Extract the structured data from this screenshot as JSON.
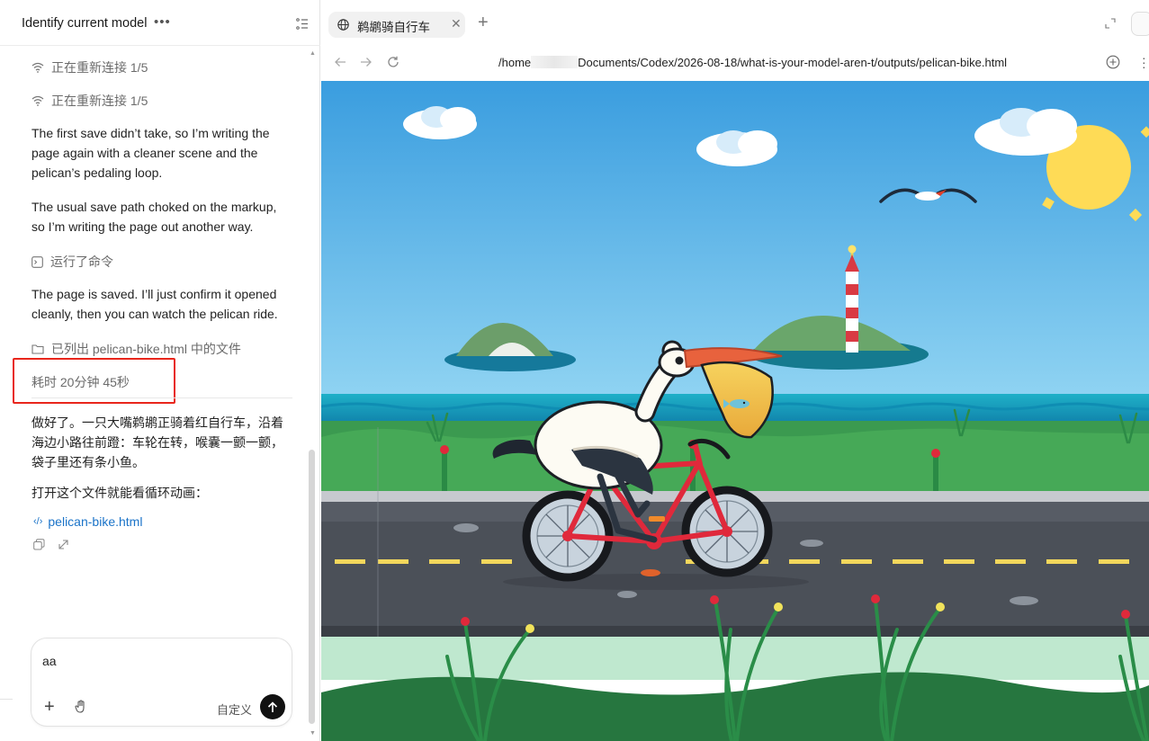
{
  "chat": {
    "title": "Identify current model",
    "status_reconnect_1": "正在重新连接 1/5",
    "status_reconnect_2": "正在重新连接 1/5",
    "para_1": "The first save didn’t take, so I’m writing the page again with a cleaner scene and the pelican’s pedaling loop.",
    "para_2": "The usual save path choked on the markup, so I’m writing the page out another way.",
    "ran_command": "运行了命令",
    "para_3": "The page is saved. I’ll just confirm it opened cleanly, then you can watch the pelican ride.",
    "listed_files": "已列出 pelican-bike.html 中的文件",
    "elapsed": "耗时 20分钟 45秒",
    "reply_1": "做好了。一只大嘴鹈鹕正骑着红自行车，沿着海边小路往前蹬：车轮在转，喉囊一颤一颤，袋子里还有条小鱼。",
    "reply_2": "打开这个文件就能看循环动画：",
    "file_link": "pelican-bike.html"
  },
  "composer": {
    "text": "aa",
    "custom_label": "自定义"
  },
  "browser": {
    "tab_title": "鹈鹕骑自行车",
    "url_prefix": "/home",
    "url_suffix": "Documents/Codex/2026-08-18/what-is-your-model-aren-t/outputs/pelican-bike.html"
  },
  "icons": {
    "more": "more-horizontal-icon",
    "list": "list-icon",
    "wifi": "wifi-icon",
    "terminal": "terminal-icon",
    "folder": "folder-icon",
    "code": "code-icon",
    "copy": "copy-icon",
    "share": "share-icon",
    "plus": "plus-icon",
    "hand": "hand-icon",
    "send": "arrow-up-icon",
    "globe": "globe-icon",
    "close": "close-icon",
    "back": "arrow-left-icon",
    "forward": "arrow-right-icon",
    "reload": "reload-icon"
  },
  "colors": {
    "highlight_box": "#e8261c",
    "link": "#1a73c8",
    "sky": "#3fa3e0",
    "bike_red": "#e0293b"
  }
}
